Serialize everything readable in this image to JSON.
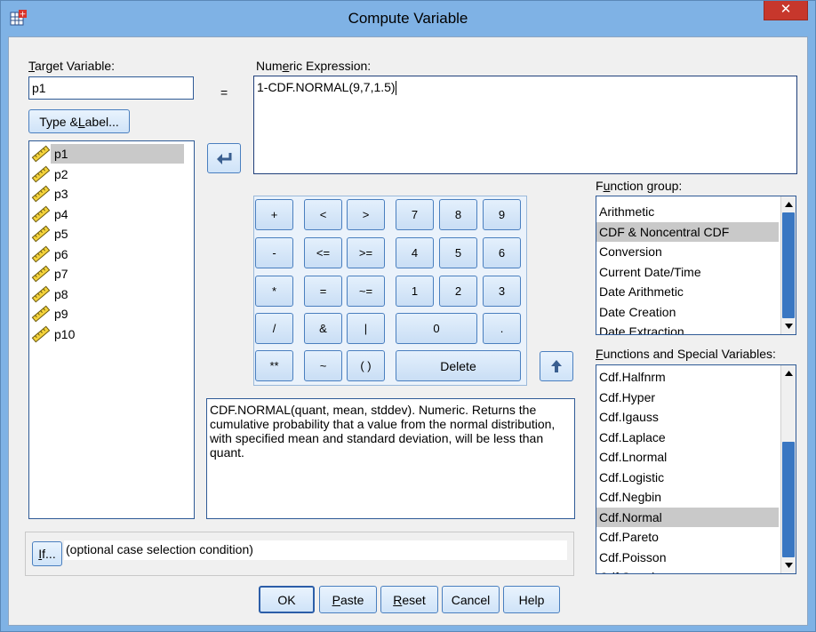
{
  "window": {
    "title": "Compute Variable",
    "close_glyph": "✕"
  },
  "target": {
    "label_prefix": "",
    "label_underlined": "T",
    "label_rest": "arget Variable:",
    "value": "p1"
  },
  "equals": "=",
  "type_label_button": {
    "pre": "Type & ",
    "u": "L",
    "post": "abel..."
  },
  "variables": [
    "p1",
    "p2",
    "p3",
    "p4",
    "p5",
    "p6",
    "p7",
    "p8",
    "p9",
    "p10"
  ],
  "expression": {
    "label_pre": "Num",
    "label_u": "e",
    "label_post": "ric Expression:",
    "value": "1-CDF.NORMAL(9,7,1.5)"
  },
  "keypad": {
    "plus": "+",
    "lt": "<",
    "gt": ">",
    "n7": "7",
    "n8": "8",
    "n9": "9",
    "minus": "-",
    "le": "<=",
    "ge": ">=",
    "n4": "4",
    "n5": "5",
    "n6": "6",
    "mult": "*",
    "eq": "=",
    "ne": "~=",
    "n1": "1",
    "n2": "2",
    "n3": "3",
    "div": "/",
    "and": "&",
    "or": "|",
    "n0": "0",
    "dot": ".",
    "pow": "**",
    "not": "~",
    "paren": "( )",
    "delete": "Delete"
  },
  "description": "CDF.NORMAL(quant, mean, stddev). Numeric. Returns the cumulative probability that a value from the normal distribution, with specified mean and standard deviation, will be less than quant.",
  "function_group": {
    "label_pre": "F",
    "label_u": "u",
    "label_post": "nction group:",
    "items": [
      "Arithmetic",
      "CDF & Noncentral CDF",
      "Conversion",
      "Current Date/Time",
      "Date Arithmetic",
      "Date Creation",
      "Date Extraction"
    ],
    "selected_index": 1
  },
  "functions": {
    "label_u": "F",
    "label_post": "unctions and Special Variables:",
    "items": [
      "Cdf.Halfnrm",
      "Cdf.Hyper",
      "Cdf.Igauss",
      "Cdf.Laplace",
      "Cdf.Lnormal",
      "Cdf.Logistic",
      "Cdf.Negbin",
      "Cdf.Normal",
      "Cdf.Pareto",
      "Cdf.Poisson",
      "Cdf.Smod"
    ],
    "selected_index": 7
  },
  "if_button": {
    "u": "I",
    "post": "f..."
  },
  "if_condition": "(optional case selection condition)",
  "buttons": {
    "ok": "OK",
    "paste": {
      "u": "P",
      "post": "aste"
    },
    "reset": {
      "u": "R",
      "post": "eset"
    },
    "cancel": "Cancel",
    "help": "Help"
  },
  "colors": {
    "accent": "#3a77c2",
    "selection": "#c9c9c9",
    "titlebar": "#7fb2e5",
    "close": "#c7372c"
  }
}
